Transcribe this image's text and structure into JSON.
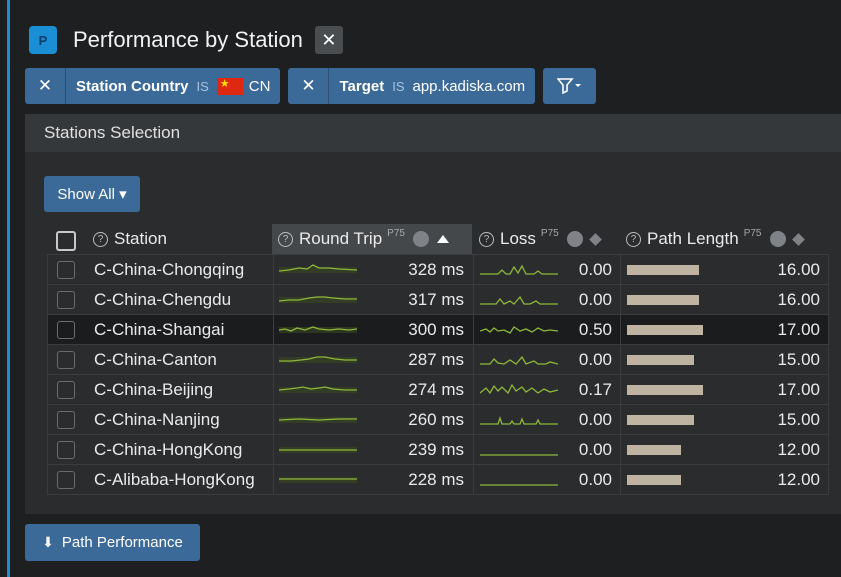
{
  "header": {
    "app_icon_letter": "P",
    "title": "Performance by Station",
    "close_symbol": "✕"
  },
  "filters": [
    {
      "key": "Station Country",
      "op": "IS",
      "value": "CN",
      "has_flag": true
    },
    {
      "key": "Target",
      "op": "IS",
      "value": "app.kadiska.com",
      "has_flag": false
    }
  ],
  "filter_remove_symbol": "✕",
  "panel": {
    "title": "Stations Selection",
    "show_all_label": "Show All ▾"
  },
  "columns": {
    "station": "Station",
    "round_trip": "Round Trip",
    "round_trip_sup": "P75",
    "loss": "Loss",
    "loss_sup": "P75",
    "path_length": "Path Length",
    "path_length_sup": "P75"
  },
  "rows": [
    {
      "station": "C-China-Chongqing",
      "round_trip": "328 ms",
      "loss": "0.00",
      "path_length": "16.00",
      "path_length_value": 16
    },
    {
      "station": "C-China-Chengdu",
      "round_trip": "317 ms",
      "loss": "0.00",
      "path_length": "16.00",
      "path_length_value": 16
    },
    {
      "station": "C-China-Shangai",
      "round_trip": "300 ms",
      "loss": "0.50",
      "path_length": "17.00",
      "path_length_value": 17
    },
    {
      "station": "C-China-Canton",
      "round_trip": "287 ms",
      "loss": "0.00",
      "path_length": "15.00",
      "path_length_value": 15
    },
    {
      "station": "C-China-Beijing",
      "round_trip": "274 ms",
      "loss": "0.17",
      "path_length": "17.00",
      "path_length_value": 17
    },
    {
      "station": "C-China-Nanjing",
      "round_trip": "260 ms",
      "loss": "0.00",
      "path_length": "15.00",
      "path_length_value": 15
    },
    {
      "station": "C-China-HongKong",
      "round_trip": "239 ms",
      "loss": "0.00",
      "path_length": "12.00",
      "path_length_value": 12
    },
    {
      "station": "C-Alibaba-HongKong",
      "round_trip": "228 ms",
      "loss": "0.00",
      "path_length": "12.00",
      "path_length_value": 12
    }
  ],
  "footer": {
    "path_performance_label": "Path Performance"
  },
  "colors": {
    "accent": "#1a8fd6",
    "button": "#3b6a99",
    "sparkline": "#8db83a",
    "bar": "#bfb3a1"
  }
}
